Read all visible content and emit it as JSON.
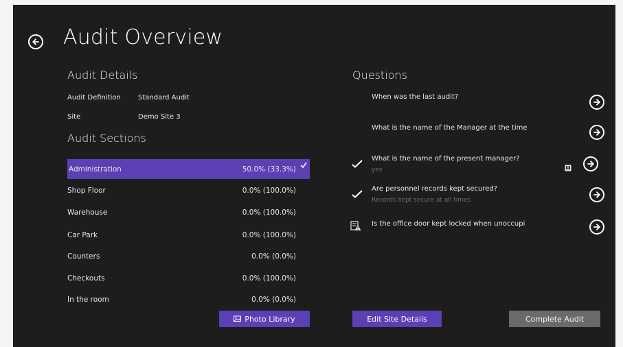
{
  "page": {
    "title": "Audit Overview",
    "back_icon": "back-arrow-circle-icon"
  },
  "details": {
    "heading": "Audit Details",
    "rows": [
      {
        "label": "Audit Definition",
        "value": "Standard Audit"
      },
      {
        "label": "Site",
        "value": "Demo Site 3"
      }
    ]
  },
  "sections": {
    "heading": "Audit Sections",
    "rows": [
      {
        "name": "Administration",
        "progress": "50.0% (33.3%)",
        "selected": true
      },
      {
        "name": "Shop Floor",
        "progress": "0.0% (100.0%)"
      },
      {
        "name": "Warehouse",
        "progress": "0.0% (100.0%)"
      },
      {
        "name": "Car Park",
        "progress": "0.0% (100.0%)"
      },
      {
        "name": "Counters",
        "progress": "0.0% (0.0%)"
      },
      {
        "name": "Checkouts",
        "progress": "0.0% (100.0%)"
      },
      {
        "name": "In the room",
        "progress": "0.0% (0.0%)"
      }
    ]
  },
  "questions": {
    "heading": "Questions",
    "items": [
      {
        "text": "When was the last audit?",
        "answer": "",
        "status": "none"
      },
      {
        "text": "What is the name of the Manager at the time",
        "answer": "",
        "status": "none"
      },
      {
        "text": "What is the name of the present manager?",
        "answer": "yes",
        "status": "answered",
        "has_photo": true
      },
      {
        "text": "Are personnel records kept secured?",
        "answer": "Records kept secure at all times",
        "status": "answered"
      },
      {
        "text": "Is the office door kept locked when unoccupi",
        "answer": "",
        "status": "warning"
      }
    ]
  },
  "buttons": {
    "photo_library": "Photo Library",
    "edit_site_details": "Edit Site Details",
    "complete_audit": "Complete Audit"
  },
  "colors": {
    "accent": "#5b3fb4",
    "background": "#1d1d1d",
    "disabled_button": "#6a6a6a"
  }
}
